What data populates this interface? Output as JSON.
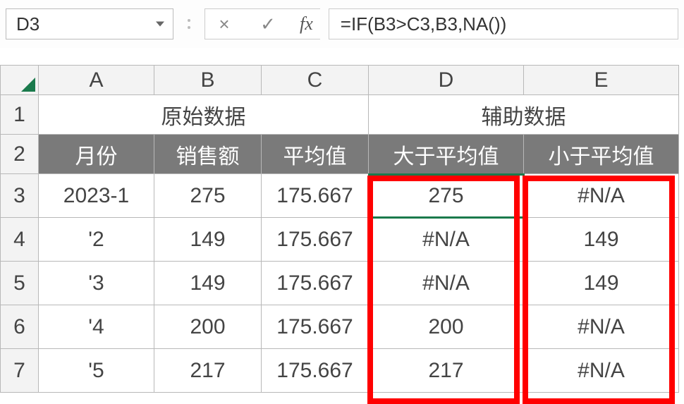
{
  "nameBox": "D3",
  "formula": "=IF(B3>C3,B3,NA())",
  "formulaControls": {
    "cancel": "×",
    "confirm": "✓",
    "fx": "fx"
  },
  "colHeaders": [
    "A",
    "B",
    "C",
    "D",
    "E"
  ],
  "rowHeaders": [
    "1",
    "2",
    "3",
    "4",
    "5",
    "6",
    "7"
  ],
  "mergedHeaders": {
    "left": "原始数据",
    "right": "辅助数据"
  },
  "subHeaders": {
    "A": "月份",
    "B": "销售额",
    "C": "平均值",
    "D": "大于平均值",
    "E": "小于平均值"
  },
  "rows": [
    {
      "A": "2023-1",
      "B": "275",
      "C": "175.667",
      "D": "275",
      "E": "#N/A"
    },
    {
      "A": "'2",
      "B": "149",
      "C": "175.667",
      "D": "#N/A",
      "E": "149"
    },
    {
      "A": "'3",
      "B": "149",
      "C": "175.667",
      "D": "#N/A",
      "E": "149"
    },
    {
      "A": "'4",
      "B": "200",
      "C": "175.667",
      "D": "200",
      "E": "#N/A"
    },
    {
      "A": "'5",
      "B": "217",
      "C": "175.667",
      "D": "217",
      "E": "#N/A"
    }
  ],
  "chart_data": {
    "type": "table",
    "title": "",
    "columns": [
      "月份",
      "销售额",
      "平均值",
      "大于平均值",
      "小于平均值"
    ],
    "data": [
      [
        "2023-1",
        275,
        175.667,
        275,
        null
      ],
      [
        "'2",
        149,
        175.667,
        null,
        149
      ],
      [
        "'3",
        149,
        175.667,
        null,
        149
      ],
      [
        "'4",
        200,
        175.667,
        200,
        null
      ],
      [
        "'5",
        217,
        175.667,
        217,
        null
      ]
    ]
  }
}
